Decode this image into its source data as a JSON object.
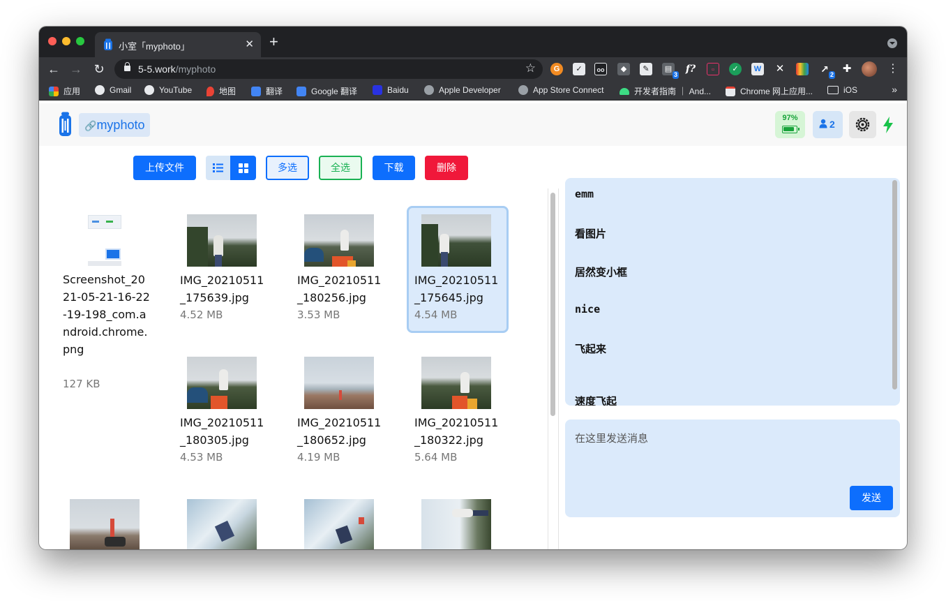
{
  "browser": {
    "tab_title": "小室「myphoto」",
    "url_host": "5-5.work",
    "url_path": "/myphoto",
    "bookmarks": [
      {
        "label": "应用",
        "icon": "apps-grid-icon"
      },
      {
        "label": "Gmail",
        "icon": "globe-icon"
      },
      {
        "label": "YouTube",
        "icon": "globe-icon"
      },
      {
        "label": "地图",
        "icon": "maps-pin-icon"
      },
      {
        "label": "翻译",
        "icon": "google-translate-icon"
      },
      {
        "label": "Google 翻译",
        "icon": "google-translate-icon"
      },
      {
        "label": "Baidu",
        "icon": "baidu-paw-icon"
      },
      {
        "label": "Apple Developer",
        "icon": "apple-icon"
      },
      {
        "label": "App Store Connect",
        "icon": "apple-icon"
      },
      {
        "label": "开发者指南 ｜ And...",
        "icon": "android-icon"
      },
      {
        "label": "Chrome 网上应用...",
        "icon": "chrome-webstore-icon"
      },
      {
        "label": "iOS",
        "icon": "folder-icon"
      }
    ],
    "extension_badges": {
      "stack": "3",
      "gesture": "2"
    }
  },
  "app": {
    "name": "myphoto",
    "battery": "97%",
    "users_count": "2",
    "colors": {
      "primary": "#0d6efd",
      "danger": "#f0183a",
      "success": "#19b153",
      "selected_bg": "#dbeafb"
    }
  },
  "actions": {
    "upload": "上传文件",
    "multi_select": "多选",
    "select_all": "全选",
    "download": "下载",
    "delete": "删除"
  },
  "files": [
    {
      "name": "Screenshot_2021-05-21-16-22-19-198_com.android.chrome.png",
      "size": "127 KB"
    },
    {
      "name": "IMG_20210511_175639.jpg",
      "size": "4.52 MB"
    },
    {
      "name": "IMG_20210511_180256.jpg",
      "size": "3.53 MB"
    },
    {
      "name": "IMG_20210511_175645.jpg",
      "size": "4.54 MB",
      "selected": true
    },
    {
      "name": "IMG_20210511_180305.jpg",
      "size": "4.53 MB"
    },
    {
      "name": "IMG_20210511_180652.jpg",
      "size": "4.19 MB"
    },
    {
      "name": "IMG_20210511_180322.jpg",
      "size": "5.64 MB"
    },
    {
      "name": "",
      "size": ""
    },
    {
      "name": "",
      "size": ""
    },
    {
      "name": "",
      "size": ""
    },
    {
      "name": "",
      "size": ""
    }
  ],
  "chat": {
    "messages": [
      "emm",
      "看图片",
      "居然变小框",
      "nice",
      "飞起来",
      "速度飞起"
    ],
    "input_placeholder": "在这里发送消息",
    "send_label": "发送"
  }
}
